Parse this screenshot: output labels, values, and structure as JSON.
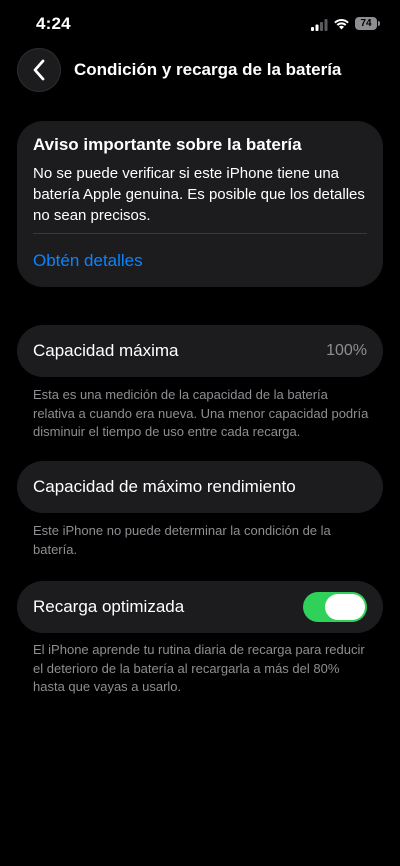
{
  "status_bar": {
    "time": "4:24",
    "battery_level": "74"
  },
  "nav": {
    "title": "Condición y recarga de la batería",
    "back_icon": "chevron-left-icon"
  },
  "notice": {
    "title": "Aviso importante sobre la batería",
    "body": "No se puede verificar si este iPhone tiene una batería Apple genuina. Es posible que los detalles no sean precisos.",
    "link": "Obtén detalles"
  },
  "max_capacity": {
    "label": "Capacidad máxima",
    "value": "100%",
    "footnote": "Esta es una medición de la capacidad de la batería relativa a cuando era nueva. Una menor capacidad podría disminuir el tiempo de uso entre cada recarga."
  },
  "peak_performance": {
    "label": "Capacidad de máximo rendimiento",
    "footnote": "Este iPhone no puede determinar la condición de la batería."
  },
  "optimized_charging": {
    "label": "Recarga optimizada",
    "enabled": true,
    "footnote": "El iPhone aprende tu rutina diaria de recarga para reducir el deterioro de la batería al recargarla a más del 80% hasta que vayas a usarlo."
  },
  "colors": {
    "accent": "#0a84ff",
    "toggle_on": "#30d158",
    "card_bg": "#1c1c1e"
  }
}
